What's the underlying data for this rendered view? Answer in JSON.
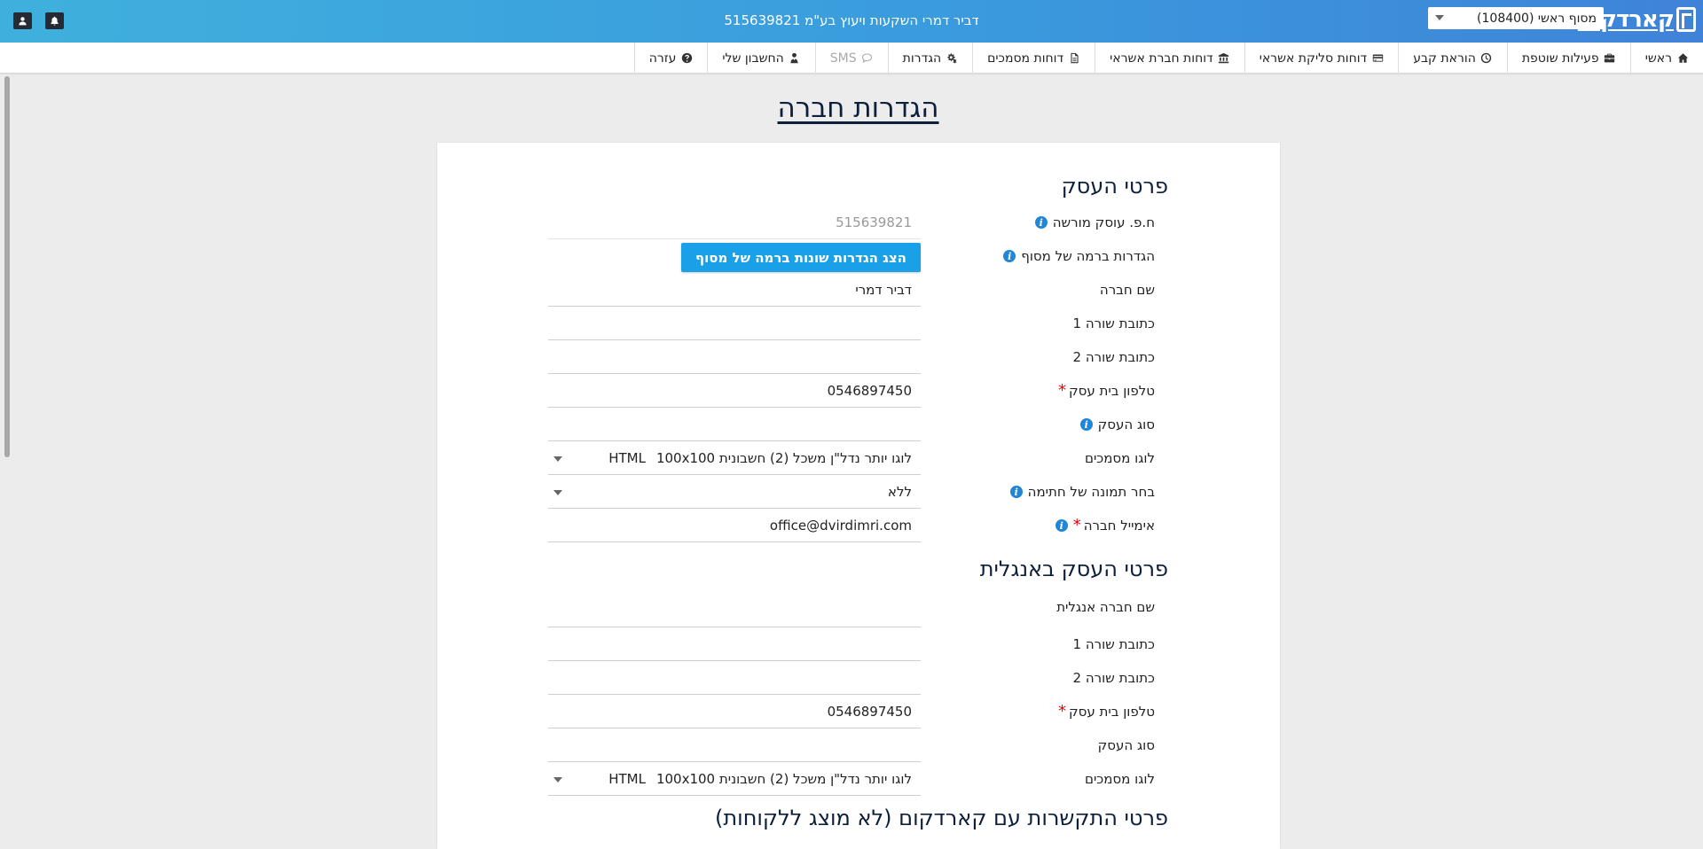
{
  "header": {
    "brand": "קארדקום",
    "terminal_select": "מסוף ראשי (108400)",
    "company_title": "דביר דמרי השקעות ויעוץ בע\"מ 515639821",
    "icons": [
      "bell-icon",
      "user-icon"
    ]
  },
  "nav": {
    "items": [
      {
        "label": "ראשי",
        "icon": "home-icon"
      },
      {
        "label": "פעילות שוטפת",
        "icon": "briefcase-icon"
      },
      {
        "label": "הוראת קבע",
        "icon": "clock-icon"
      },
      {
        "label": "דוחות סליקת אשראי",
        "icon": "credit-card-icon"
      },
      {
        "label": "דוחות חברת אשראי",
        "icon": "bank-icon"
      },
      {
        "label": "דוחות מסמכים",
        "icon": "document-icon"
      },
      {
        "label": "הגדרות",
        "icon": "gears-icon"
      },
      {
        "label": "SMS",
        "icon": "comment-icon"
      },
      {
        "label": "החשבון שלי",
        "icon": "user-tie-icon"
      },
      {
        "label": "עזרה",
        "icon": "question-icon"
      }
    ]
  },
  "page": {
    "title": "הגדרות חברה"
  },
  "business": {
    "title": "פרטי העסק",
    "tax_id_label": "ח.פ. עוסק מורשה",
    "tax_id_value": "515639821",
    "terminal_settings_label": "הגדרות ברמה של מסוף",
    "terminal_settings_button": "הצג הגדרות שונות ברמה של מסוף",
    "company_name_label": "שם חברה",
    "company_name_value": "דביר דמרי",
    "address1_label": "כתובת שורה 1",
    "address1_value": "",
    "address2_label": "כתובת שורה 2",
    "address2_value": "",
    "phone_label": "טלפון בית עסק",
    "phone_value": "0546897450",
    "business_type_label": "סוג העסק",
    "business_type_value": "",
    "logo_label": "לוגו מסמכים",
    "logo_value": "לוגו יותר נדל\"ן משכל (2) חשבונית 100x100",
    "logo_value_suffix": "HTML",
    "signature_label": "בחר תמונה של חתימה",
    "signature_value": "ללא",
    "email_label": "אימייל חברה",
    "email_value": "office@dvirdimri.com"
  },
  "business_en": {
    "title": "פרטי העסק באנגלית",
    "company_name_label": "שם חברה אנגלית",
    "company_name_value": "",
    "address1_label": "כתובת שורה 1",
    "address1_value": "",
    "address2_label": "כתובת שורה 2",
    "address2_value": "",
    "phone_label": "טלפון בית עסק",
    "phone_value": "0546897450",
    "business_type_label": "סוג העסק",
    "business_type_value": "",
    "logo_label": "לוגו מסמכים",
    "logo_value": "לוגו יותר נדל\"ן משכל (2) חשבונית 100x100",
    "logo_value_suffix": "HTML"
  },
  "contact": {
    "title": "פרטי התקשרות עם קארדקום (לא מוצג ללקוחות)"
  },
  "colors": {
    "header_gradient_start": "#3fb0dd",
    "header_gradient_end": "#3f83d9",
    "button_blue": "#1aa0e6",
    "required": "#ee0000",
    "info_icon": "#2286d6"
  }
}
